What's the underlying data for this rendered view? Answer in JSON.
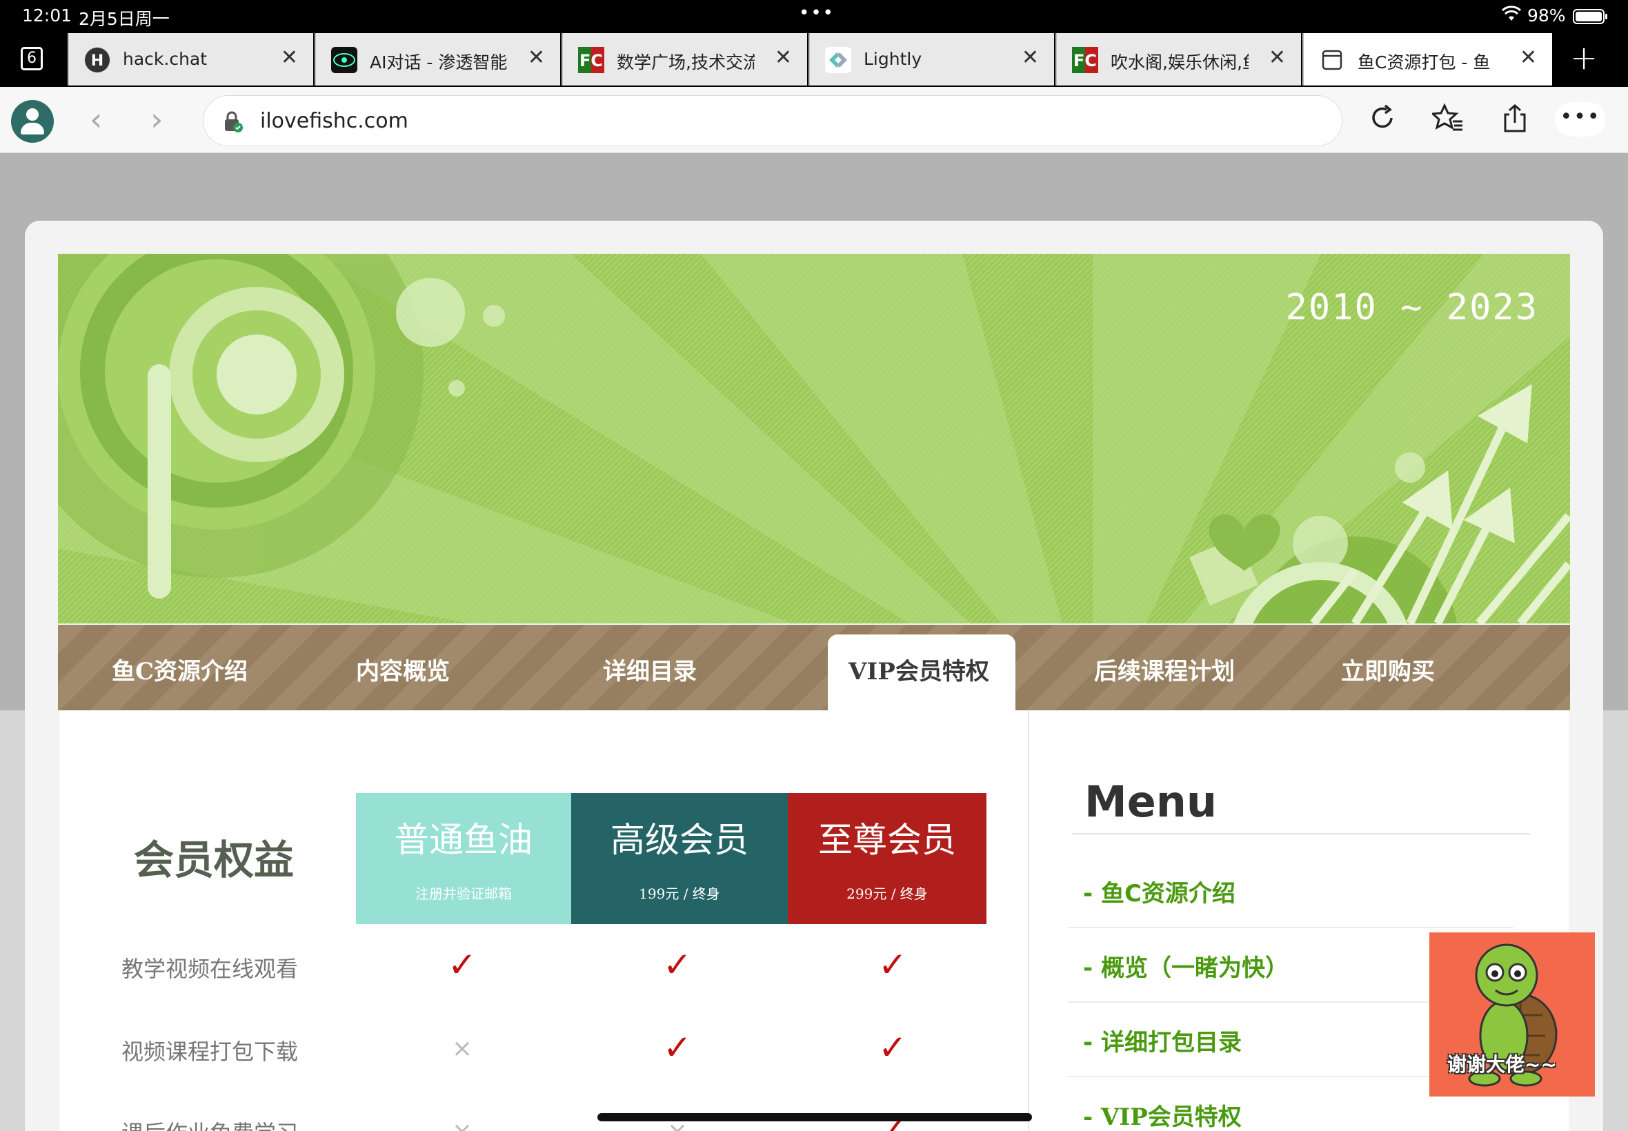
{
  "status": {
    "time": "12:01",
    "date": "2月5日周一",
    "battery": "98%"
  },
  "tabs": {
    "count": "6",
    "items": [
      {
        "title": "hack.chat",
        "icon": "hack-chat-icon"
      },
      {
        "title": "AI对话 - 渗透智能",
        "icon": "ai-chat-icon"
      },
      {
        "title": "数学广场,技术交流",
        "icon": "fishc-icon"
      },
      {
        "title": "Lightly",
        "icon": "lightly-icon"
      },
      {
        "title": "吹水阁,娱乐休闲,鱼",
        "icon": "fishc-icon"
      },
      {
        "title": "鱼C资源打包 - 鱼",
        "icon": "page-icon"
      }
    ]
  },
  "toolbar": {
    "url": "ilovefishc.com"
  },
  "banner": {
    "years": "2010 ~ 2023"
  },
  "nav": {
    "items": [
      "鱼C资源介绍",
      "内容概览",
      "详细目录",
      "后续课程计划",
      "立即购买"
    ],
    "active": "VIP会员特权"
  },
  "benefits": {
    "title": "会员权益",
    "plans": [
      {
        "name": "普通鱼油",
        "price": "注册并验证邮箱",
        "color": "#96e1d4"
      },
      {
        "name": "高级会员",
        "price": "199元 / 终身",
        "color": "#246466"
      },
      {
        "name": "至尊会员",
        "price": "299元 / 终身",
        "color": "#b11f1c"
      }
    ],
    "rows": [
      {
        "label": "教学视频在线观看",
        "marks": [
          "✓",
          "✓",
          "✓"
        ]
      },
      {
        "label": "视频课程打包下载",
        "marks": [
          "×",
          "✓",
          "✓"
        ]
      },
      {
        "label": "课后作业免费学习",
        "marks": [
          "×",
          "×",
          "✓"
        ]
      }
    ]
  },
  "menu": {
    "title": "Menu",
    "items": [
      "- 鱼C资源介绍",
      "- 概览（一睹为快）",
      "- 详细打包目录",
      "- VIP会员特权"
    ]
  },
  "sticker": {
    "text": "谢谢大佬~~"
  }
}
